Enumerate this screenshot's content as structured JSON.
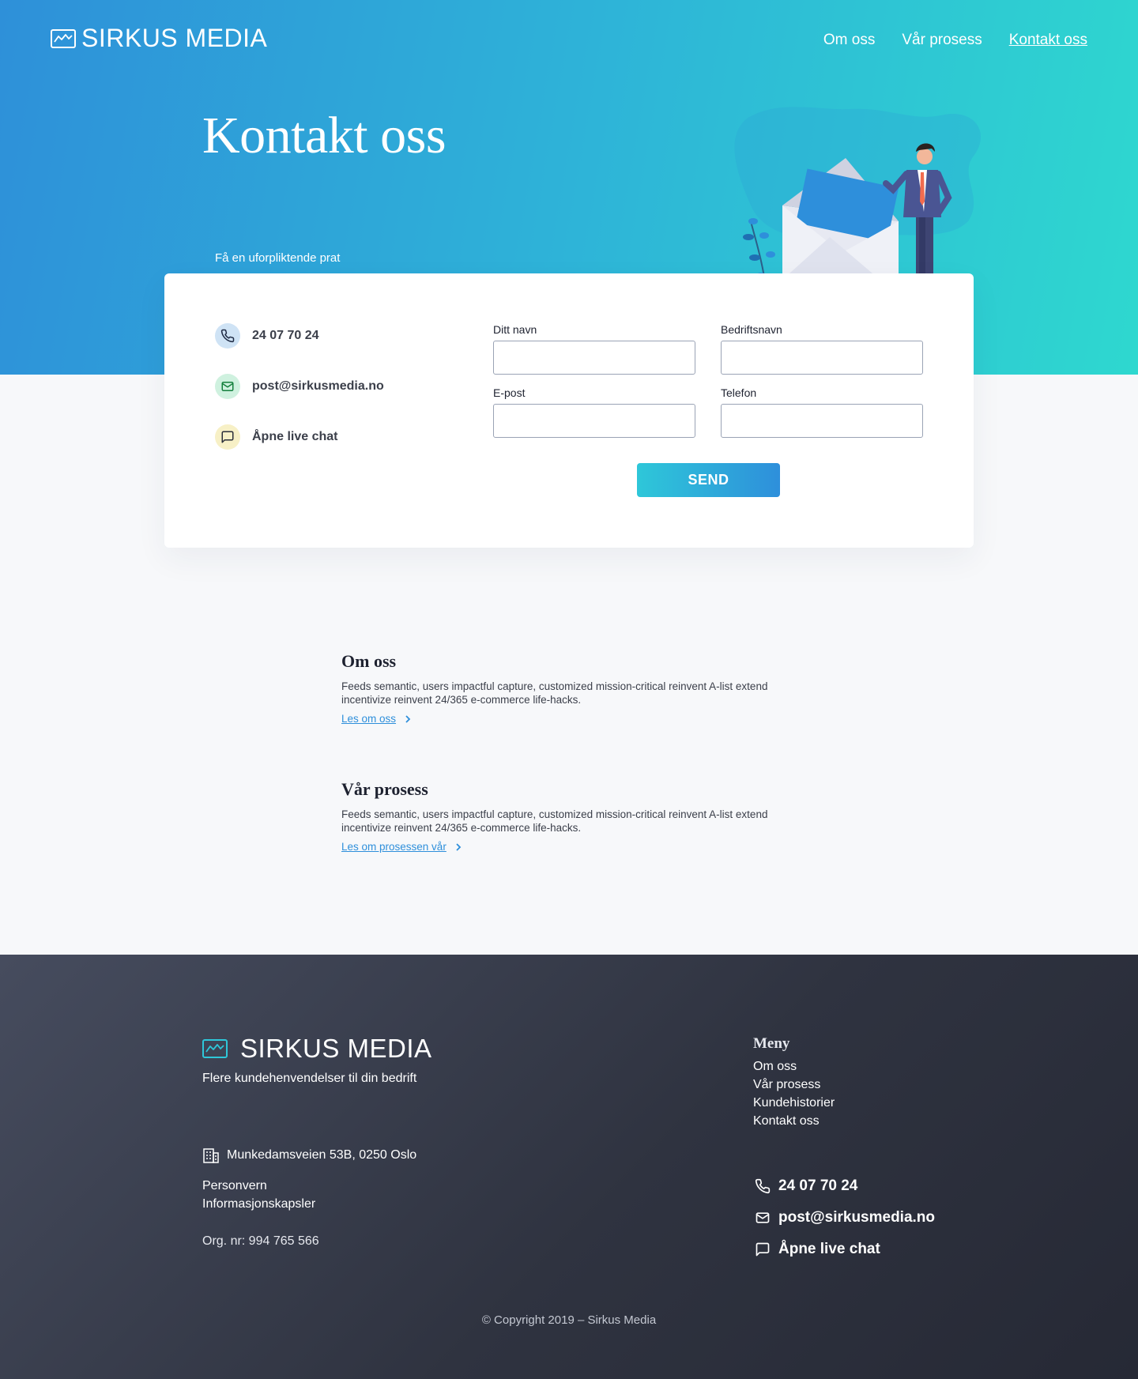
{
  "brand": {
    "name": "SIRKUS MEDIA",
    "accent": "#2ec7d9",
    "logo_icon": "chart-line-icon"
  },
  "nav": {
    "items": [
      {
        "label": "Om oss"
      },
      {
        "label": "Vår prosess"
      },
      {
        "label": "Kontakt oss",
        "active": true
      }
    ]
  },
  "hero": {
    "title": "Kontakt oss",
    "subtitle": "Få en uforpliktende prat"
  },
  "contact": {
    "phone": "24 07 70 24",
    "email": "post@sirkusmedia.no",
    "chat": "Åpne live chat",
    "icons": [
      "phone-icon",
      "mail-icon",
      "chat-icon"
    ]
  },
  "form": {
    "name_label": "Ditt navn",
    "company_label": "Bedriftsnavn",
    "email_label": "E-post",
    "phone_label": "Telefon",
    "name_value": "",
    "company_value": "",
    "email_value": "",
    "phone_value": "",
    "submit_label": "SEND"
  },
  "sections": [
    {
      "title": "Om oss",
      "text": "Feeds semantic, users impactful capture, customized mission-critical reinvent A-list extend incentivize reinvent 24/365 e-commerce life-hacks.",
      "link": "Les om oss"
    },
    {
      "title": "Vår prosess",
      "text": "Feeds semantic, users impactful capture, customized mission-critical reinvent A-list extend incentivize reinvent 24/365 e-commerce life-hacks.",
      "link": "Les om prosessen vår"
    }
  ],
  "footer": {
    "tagline": "Flere kundehenvendelser til din bedrift",
    "address": "Munkedamsveien 53B, 0250 Oslo",
    "links": [
      "Personvern",
      "Informasjonskapsler"
    ],
    "org": "Org. nr: 994 765 566",
    "menu_title": "Meny",
    "menu": [
      "Om oss",
      "Vår prosess",
      "Kundehistorier",
      "Kontakt oss"
    ],
    "phone": "24 07 70 24",
    "email": "post@sirkusmedia.no",
    "chat": "Åpne live chat",
    "copyright": "© Copyright 2019 – Sirkus Media"
  }
}
